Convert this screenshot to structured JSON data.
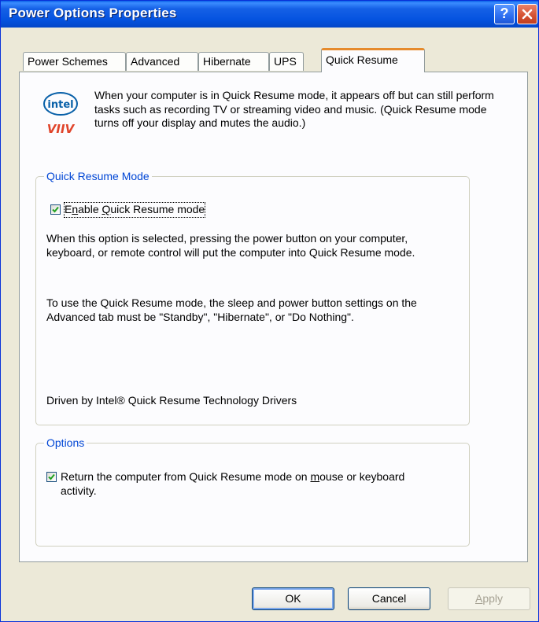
{
  "window": {
    "title": "Power Options Properties",
    "help_glyph": "?",
    "close_glyph": "✕"
  },
  "tabs": [
    {
      "label": "Power Schemes",
      "active": false
    },
    {
      "label": "Advanced",
      "active": false
    },
    {
      "label": "Hibernate",
      "active": false
    },
    {
      "label": "UPS",
      "active": false
    },
    {
      "label": "Quick Resume",
      "active": true
    }
  ],
  "logo": {
    "top_text": "intel",
    "bottom_text": "VIIV",
    "icon": "intel-viiv-logo"
  },
  "intro_text": "When your computer is in Quick Resume mode, it appears off but can still perform tasks such as recording TV or streaming video and music. (Quick Resume mode turns off your display and mutes the audio.)",
  "quick_resume_group": {
    "title": "Quick Resume Mode",
    "checkbox": {
      "pre": "E",
      "accel": "n",
      "post": "able ",
      "accel2": "Q",
      "post2": "uick Resume mode",
      "checked": true
    },
    "para1": "When this option is selected, pressing the power button on your computer, keyboard, or remote control will put the computer into Quick Resume mode.",
    "para2": "To use the Quick Resume mode, the sleep and power button settings on the Advanced tab must be \"Standby\", \"Hibernate\", or \"Do Nothing\".",
    "driver_text": "Driven by Intel® Quick Resume Technology Drivers"
  },
  "options_group": {
    "title": "Options",
    "checkbox": {
      "pre": "Return the computer from Quick Resume mode on ",
      "accel": "m",
      "post": "ouse or keyboard activity.",
      "checked": true
    }
  },
  "buttons": {
    "ok": "OK",
    "cancel": "Cancel",
    "apply_pre": "",
    "apply_accel": "A",
    "apply_post": "pply"
  },
  "colors": {
    "titlebar": "#0553e0",
    "dialog_bg": "#ece9d8",
    "group_title": "#0046d5",
    "active_tab_accent": "#e68b2c",
    "checkmark": "#21a121"
  }
}
